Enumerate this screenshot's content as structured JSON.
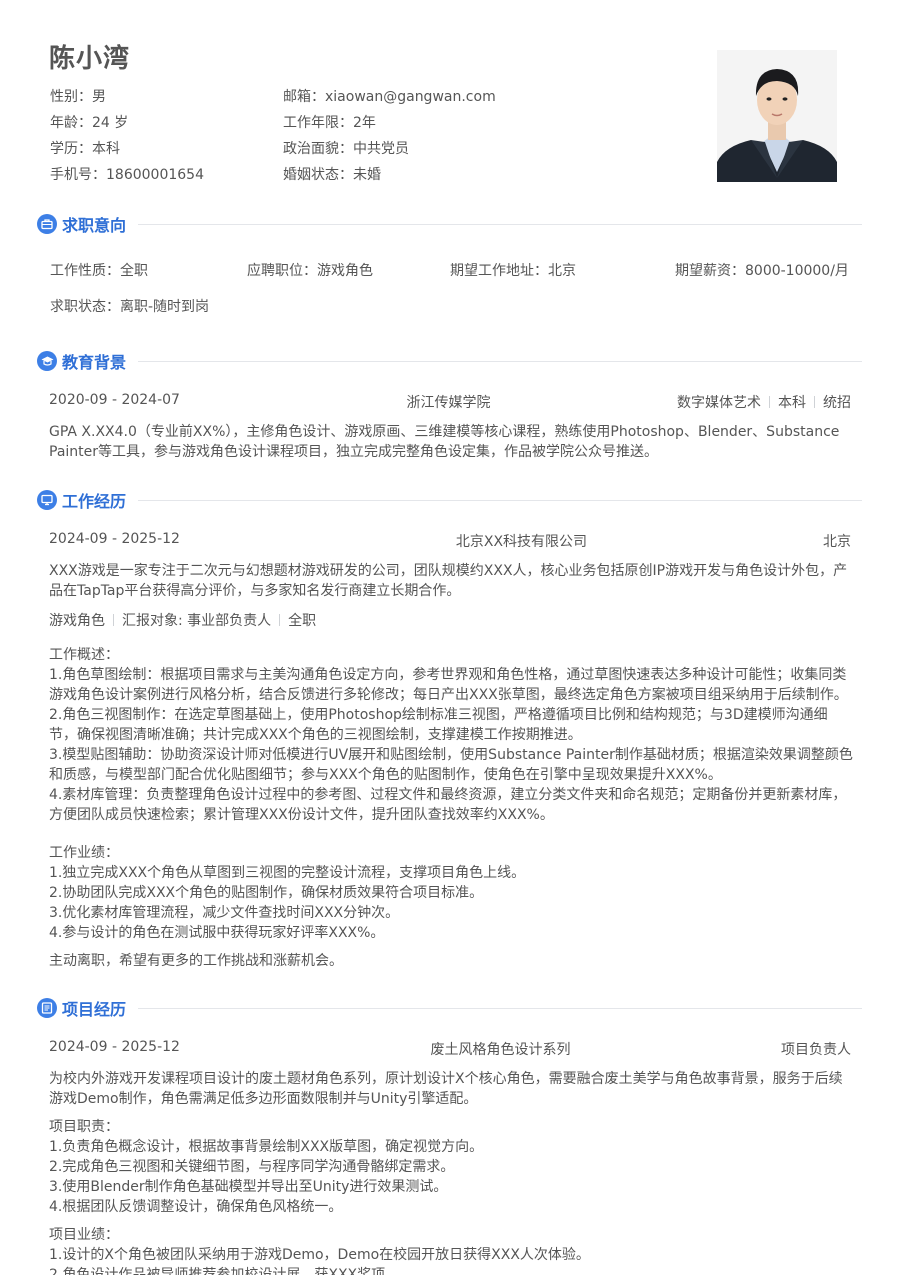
{
  "profile": {
    "name": "陈小湾",
    "left": [
      {
        "label": "性别：",
        "value": "男"
      },
      {
        "label": "年龄：",
        "value": "24 岁"
      },
      {
        "label": "学历：",
        "value": "本科"
      },
      {
        "label": "手机号：",
        "value": "18600001654"
      }
    ],
    "right": [
      {
        "label": "邮箱：",
        "value": "xiaowan@gangwan.com"
      },
      {
        "label": "工作年限：",
        "value": "2年"
      },
      {
        "label": "政治面貌：",
        "value": "中共党员"
      },
      {
        "label": "婚姻状态：",
        "value": "未婚"
      }
    ]
  },
  "job_intent": {
    "title": "求职意向",
    "nature_label": "工作性质：",
    "nature": "全职",
    "position_label": "应聘职位：",
    "position": "游戏角色",
    "location_label": "期望工作地址：",
    "location": "北京",
    "salary_label": "期望薪资：",
    "salary": "8000-10000/月",
    "status_label": "求职状态：",
    "status": "离职-随时到岗"
  },
  "education": {
    "title": "教育背景",
    "period": "2020-09 - 2024-07",
    "school": "浙江传媒学院",
    "major": "数字媒体艺术",
    "degree": "本科",
    "type": "统招",
    "desc": [
      "GPA X.XX4.0（专业前XX%），主修角色设计、游戏原画、三维建模等核心课程，熟练使用Photoshop、Blender、Substance",
      "Painter等工具，参与游戏角色设计课程项目，独立完成完整角色设定集，作品被学院公众号推送。"
    ]
  },
  "work": {
    "title": "工作经历",
    "period": "2024-09 - 2025-12",
    "company": "北京XX科技有限公司",
    "city": "北京",
    "company_desc": [
      "XXX游戏是一家专注于二次元与幻想题材游戏研发的公司，团队规模约XXX人，核心业务包括原创IP游戏开发与角色设计外包，产",
      "品在TapTap平台获得高分评价，与多家知名发行商建立长期合作。"
    ],
    "role": "游戏角色",
    "report": "汇报对象: 事业部负责人",
    "jobtype": "全职",
    "overview_label": "工作概述：",
    "overview": [
      "1.角色草图绘制：根据项目需求与主美沟通角色设定方向，参考世界观和角色性格，通过草图快速表达多种设计可能性；收集同类",
      "游戏角色设计案例进行风格分析，结合反馈进行多轮修改；每日产出XXX张草图，最终选定角色方案被项目组采纳用于后续制作。",
      "2.角色三视图制作：在选定草图基础上，使用Photoshop绘制标准三视图，严格遵循项目比例和结构规范；与3D建模师沟通细",
      "节，确保视图清晰准确；共计完成XXX个角色的三视图绘制，支撑建模工作按期推进。",
      "3.模型贴图辅助：协助资深设计师对低模进行UV展开和贴图绘制，使用Substance Painter制作基础材质；根据渲染效果调整颜色",
      "和质感，与模型部门配合优化贴图细节；参与XXX个角色的贴图制作，使角色在引擎中呈现效果提升XXX%。",
      "4.素材库管理：负责整理角色设计过程中的参考图、过程文件和最终资源，建立分类文件夹和命名规范；定期备份并更新素材库，",
      "方便团队成员快速检索；累计管理XXX份设计文件，提升团队查找效率约XXX%。"
    ],
    "achieve_label": "工作业绩：",
    "achievements": [
      "1.独立完成XXX个角色从草图到三视图的完整设计流程，支撑项目角色上线。",
      "2.协助团队完成XXX个角色的贴图制作，确保材质效果符合项目标准。",
      "3.优化素材库管理流程，减少文件查找时间XXX分钟次。",
      "4.参与设计的角色在测试服中获得玩家好评率XXX%。"
    ],
    "leave_reason": "主动离职，希望有更多的工作挑战和涨薪机会。"
  },
  "project": {
    "title": "项目经历",
    "period": "2024-09 - 2025-12",
    "name": "废土风格角色设计系列",
    "role": "项目负责人",
    "desc": [
      "为校内外游戏开发课程项目设计的废土题材角色系列，原计划设计X个核心角色，需要融合废土美学与角色故事背景，服务于后续",
      "游戏Demo制作，角色需满足低多边形面数限制并与Unity引擎适配。"
    ],
    "duty_label": "项目职责：",
    "duties": [
      "1.负责角色概念设计，根据故事背景绘制XXX版草图，确定视觉方向。",
      "2.完成角色三视图和关键细节图，与程序同学沟通骨骼绑定需求。",
      "3.使用Blender制作角色基础模型并导出至Unity进行效果测试。",
      "4.根据团队反馈调整设计，确保角色风格统一。"
    ],
    "achieve_label": "项目业绩：",
    "achievements": [
      "1.设计的X个角色被团队采纳用于游戏Demo，Demo在校园开放日获得XXX人次体验。",
      "2.角色设计作品被导师推荐参加校设计展，获XXX奖项。"
    ]
  },
  "colors": {
    "accent": "#2f6fd6",
    "icon": "#3d7fe6",
    "text": "#555555"
  }
}
